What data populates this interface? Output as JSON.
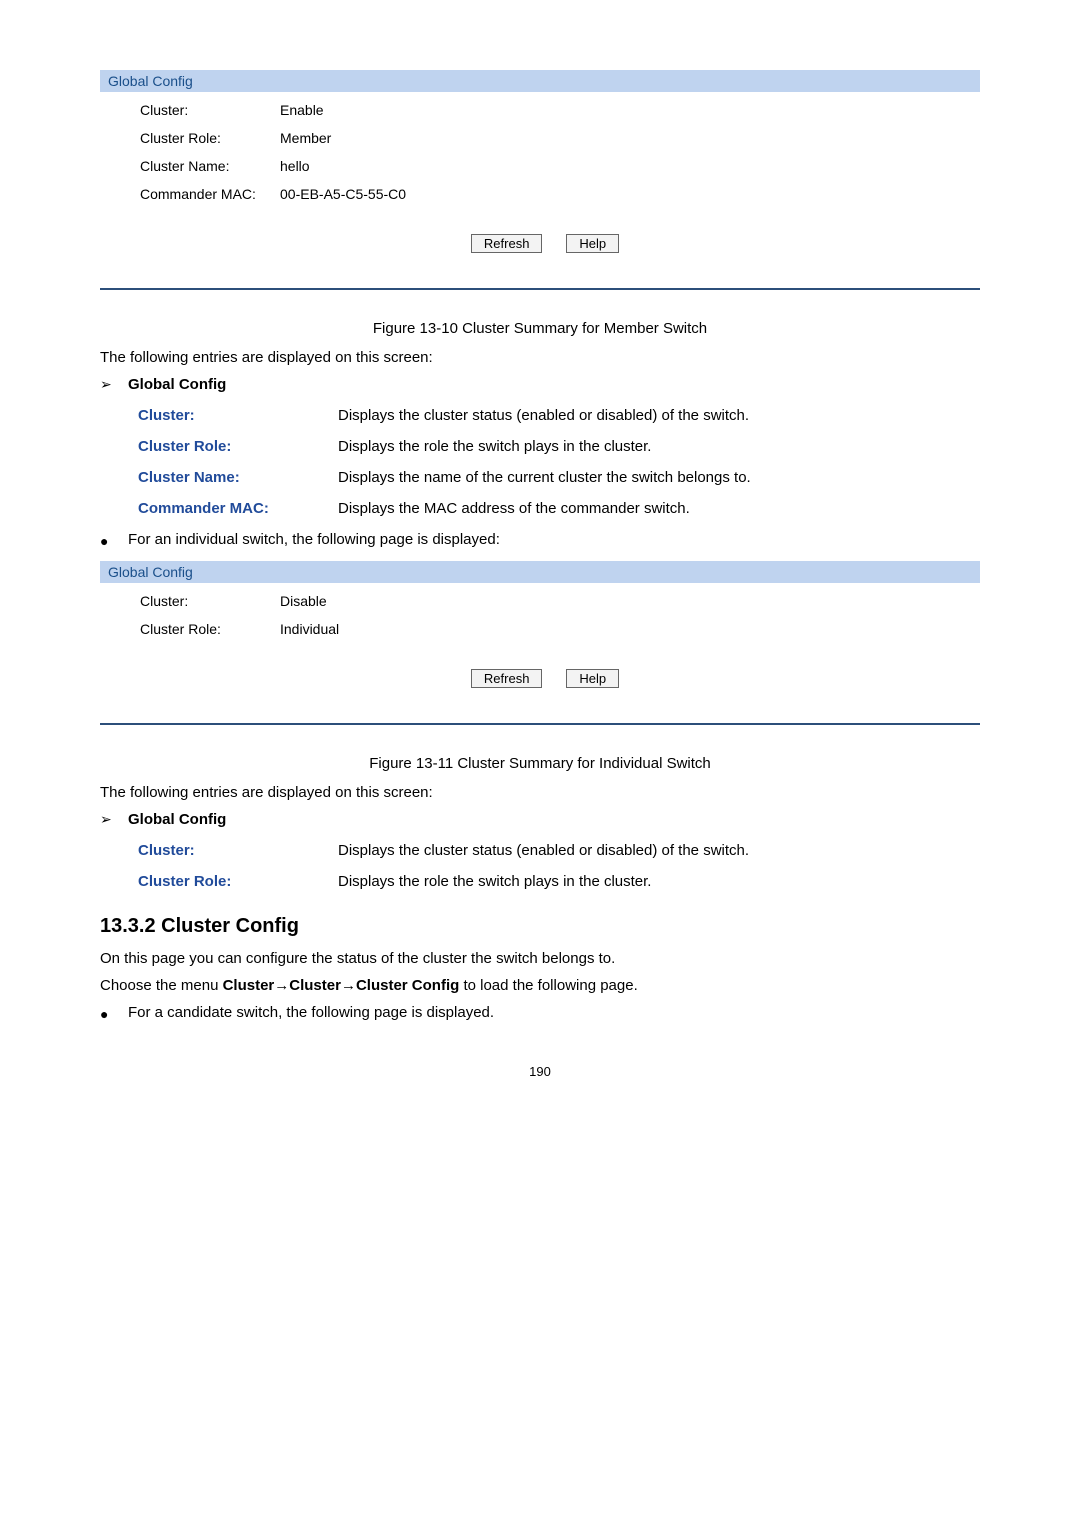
{
  "fig1": {
    "header": "Global Config",
    "rows": [
      {
        "label": "Cluster:",
        "value": "Enable"
      },
      {
        "label": "Cluster Role:",
        "value": "Member"
      },
      {
        "label": "Cluster Name:",
        "value": "hello"
      },
      {
        "label": "Commander MAC:",
        "value": "00-EB-A5-C5-55-C0"
      }
    ],
    "refresh": "Refresh",
    "help": "Help",
    "caption": "Figure 13-10 Cluster Summary for Member Switch"
  },
  "intro1": "The following entries are displayed on this screen:",
  "sec1": {
    "title": "Global Config",
    "defs": [
      {
        "term": "Cluster:",
        "desc": "Displays the cluster status (enabled or disabled) of the switch."
      },
      {
        "term": "Cluster Role:",
        "desc": "Displays the role the switch plays in the cluster."
      },
      {
        "term": "Cluster Name:",
        "desc": "Displays the name of the current cluster the switch belongs to."
      },
      {
        "term": "Commander MAC:",
        "desc": "Displays the MAC address of the commander switch."
      }
    ]
  },
  "bullet1": "For an individual switch, the following page is displayed:",
  "fig2": {
    "header": "Global Config",
    "rows": [
      {
        "label": "Cluster:",
        "value": "Disable"
      },
      {
        "label": "Cluster Role:",
        "value": "Individual"
      }
    ],
    "refresh": "Refresh",
    "help": "Help",
    "caption": "Figure 13-11 Cluster Summary for Individual Switch"
  },
  "intro2": "The following entries are displayed on this screen:",
  "sec2": {
    "title": "Global Config",
    "defs": [
      {
        "term": "Cluster:",
        "desc": "Displays the cluster status (enabled or disabled) of the switch."
      },
      {
        "term": "Cluster Role:",
        "desc": "Displays the role the switch plays in the cluster."
      }
    ]
  },
  "heading": "13.3.2  Cluster Config",
  "p1": "On this page you can configure the status of the cluster the switch belongs to.",
  "p2a": "Choose the menu ",
  "p2b": "Cluster→Cluster→Cluster Config",
  "p2c": " to load the following page.",
  "bullet2": "For a candidate switch, the following page is displayed.",
  "pagenum": "190"
}
